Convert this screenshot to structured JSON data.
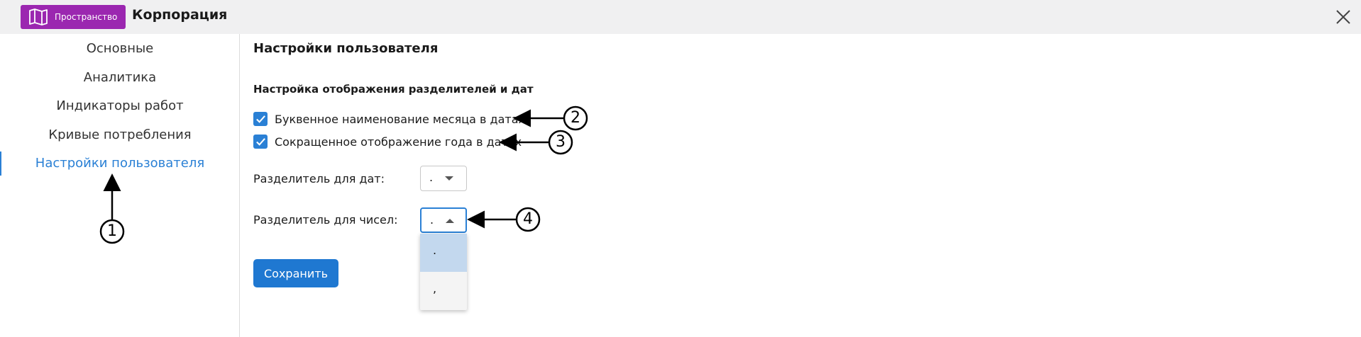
{
  "header": {
    "badge_label": "Пространство",
    "app_title": "Корпорация",
    "badge_color": "#9b27b0"
  },
  "sidebar": {
    "items": [
      {
        "label": "Основные",
        "active": false
      },
      {
        "label": "Аналитика",
        "active": false
      },
      {
        "label": "Индикаторы работ",
        "active": false
      },
      {
        "label": "Кривые потребления",
        "active": false
      },
      {
        "label": "Настройки пользователя",
        "active": true
      }
    ]
  },
  "main": {
    "title": "Настройки пользователя",
    "section_title": "Настройка отображения разделителей и дат",
    "checkboxes": [
      {
        "label": "Буквенное наименование месяца в датах",
        "checked": true
      },
      {
        "label": "Сокращенное отображение года в датах",
        "checked": true
      }
    ],
    "date_separator": {
      "label": "Разделитель для дат:",
      "value": "."
    },
    "number_separator": {
      "label": "Разделитель для чисел:",
      "value": ".",
      "open": true,
      "options": [
        ".",
        ","
      ]
    },
    "save_label": "Сохранить"
  },
  "callouts": [
    "1",
    "2",
    "3",
    "4"
  ],
  "colors": {
    "accent": "#2a80d5",
    "button": "#1f78d1",
    "option_selected": "#c3d8ee"
  }
}
